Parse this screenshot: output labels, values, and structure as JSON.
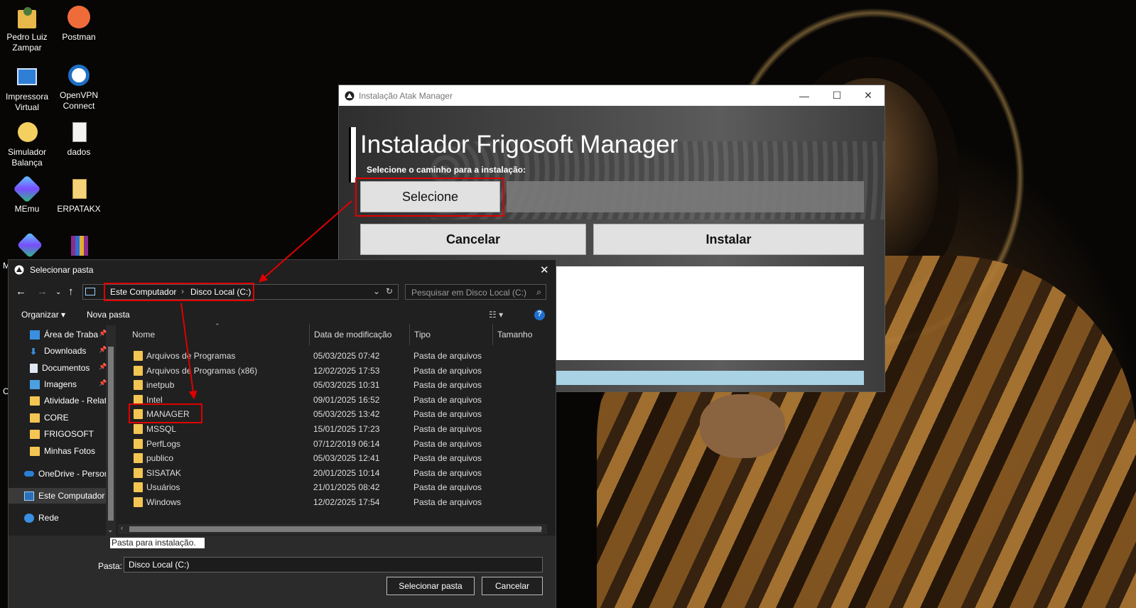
{
  "desktop": {
    "icons": [
      {
        "label": "Pedro Luiz Zampar",
        "icon": "user-folder-icon"
      },
      {
        "label": "Postman",
        "icon": "postman-icon"
      },
      {
        "label": "Impressora Virtual",
        "icon": "printer-icon"
      },
      {
        "label": "OpenVPN Connect",
        "icon": "openvpn-icon"
      },
      {
        "label": "Simulador Balança",
        "icon": "python-icon"
      },
      {
        "label": "dados",
        "icon": "spreadsheet-icon"
      },
      {
        "label": "MEmu",
        "icon": "memu-icon"
      },
      {
        "label": "ERPATAKX",
        "icon": "file-icon"
      },
      {
        "label": "M",
        "icon": "app-icon"
      }
    ]
  },
  "installer": {
    "window_title": "Instalação Atak Manager",
    "heading": "Instalador Frigosoft Manager",
    "path_label": "Selecione o caminho para a instalação:",
    "select_label": "Selecione",
    "cancel_label": "Cancelar",
    "install_label": "Instalar",
    "controls": {
      "minimize": "—",
      "maximize": "☐",
      "close": "✕"
    }
  },
  "dialog": {
    "title": "Selecionar pasta",
    "close": "✕",
    "breadcrumb": [
      "Este Computador",
      "Disco Local (C:)"
    ],
    "search_placeholder": "Pesquisar em Disco Local (C:)",
    "organize": "Organizar ▾",
    "new_folder": "Nova pasta",
    "help": "?",
    "sidebar": [
      {
        "label": "Área de Traba",
        "icon": "desktop-icon",
        "pinned": true
      },
      {
        "label": "Downloads",
        "icon": "download-icon",
        "pinned": true
      },
      {
        "label": "Documentos",
        "icon": "document-icon",
        "pinned": true
      },
      {
        "label": "Imagens",
        "icon": "image-icon",
        "pinned": true
      },
      {
        "label": "Atividade - Relat",
        "icon": "folder-icon"
      },
      {
        "label": "CORE",
        "icon": "folder-icon"
      },
      {
        "label": "FRIGOSOFT",
        "icon": "folder-icon"
      },
      {
        "label": "Minhas Fotos",
        "icon": "folder-icon"
      },
      {
        "label": "OneDrive - Person",
        "icon": "cloud-icon"
      },
      {
        "label": "Este Computador",
        "icon": "computer-icon"
      },
      {
        "label": "Rede",
        "icon": "network-icon"
      }
    ],
    "columns": [
      "Nome",
      "Data de modificação",
      "Tipo",
      "Tamanho"
    ],
    "rows": [
      {
        "name": "Arquivos de Programas",
        "date": "05/03/2025 07:42",
        "type": "Pasta de arquivos"
      },
      {
        "name": "Arquivos de Programas (x86)",
        "date": "12/02/2025 17:53",
        "type": "Pasta de arquivos"
      },
      {
        "name": "inetpub",
        "date": "05/03/2025 10:31",
        "type": "Pasta de arquivos"
      },
      {
        "name": "Intel",
        "date": "09/01/2025 16:52",
        "type": "Pasta de arquivos"
      },
      {
        "name": "MANAGER",
        "date": "05/03/2025 13:42",
        "type": "Pasta de arquivos"
      },
      {
        "name": "MSSQL",
        "date": "15/01/2025 17:23",
        "type": "Pasta de arquivos"
      },
      {
        "name": "PerfLogs",
        "date": "07/12/2019 06:14",
        "type": "Pasta de arquivos"
      },
      {
        "name": "publico",
        "date": "05/03/2025 12:41",
        "type": "Pasta de arquivos"
      },
      {
        "name": "SISATAK",
        "date": "20/01/2025 10:14",
        "type": "Pasta de arquivos"
      },
      {
        "name": "Usuários",
        "date": "21/01/2025 08:42",
        "type": "Pasta de arquivos"
      },
      {
        "name": "Windows",
        "date": "12/02/2025 17:54",
        "type": "Pasta de arquivos"
      }
    ],
    "tooltip": "Pasta para instalação.",
    "folder_label": "Pasta:",
    "folder_value": "Disco Local (C:)",
    "select_button": "Selecionar pasta",
    "cancel_button": "Cancelar"
  },
  "annotation_color": "#e00000"
}
